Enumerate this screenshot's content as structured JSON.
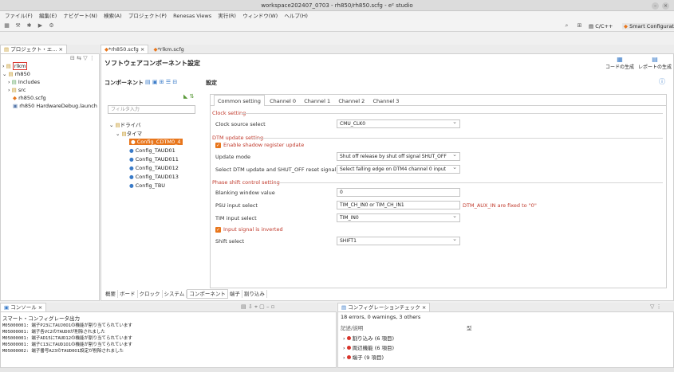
{
  "window": {
    "title": "workspace202407_0703 - rh850/rh850.scfg - e² studio"
  },
  "menu": [
    "ファイル(F)",
    "編集(E)",
    "ナビゲート(N)",
    "検索(A)",
    "プロジェクト(P)",
    "Renesas Views",
    "実行(R)",
    "ウィンドウ(W)",
    "ヘルプ(H)"
  ],
  "toolbar": {
    "perspective_cc": "C/C++",
    "perspective_sc": "Smart Configurator"
  },
  "explorer": {
    "tab_label": "プロジェクト・エ...",
    "items": [
      "rlkm",
      "rh850",
      "Includes",
      "src",
      "rh850.scfg",
      "rh850 HardwareDebug.launch"
    ]
  },
  "editor": {
    "tabs": [
      "*rh850.scfg",
      "*rlkm.scfg"
    ],
    "title": "ソフトウェアコンポーネント設定",
    "gen_code": "コードの生成",
    "gen_report": "レポートの生成",
    "component_label": "コンポーネント",
    "settings_label": "設定",
    "filter_placeholder": "フィルタ入力",
    "tree": [
      "ドライバ",
      "タイマ",
      "Config_CDTM0_4",
      "Config_TAUD01",
      "Config_TAUD011",
      "Config_TAUD012",
      "Config_TAUD013",
      "Config_TBU"
    ],
    "setting_tabs": [
      "Common setting",
      "Channel 0",
      "Channel 1",
      "Channel 2",
      "Channel 3"
    ],
    "clock_section": "Clock setting",
    "clock_source_label": "Clock source select",
    "clock_source_value": "CMU_CLK0",
    "dtm_section": "DTM update setting",
    "shadow_label": "Enable shadow register update",
    "update_mode_label": "Update mode",
    "update_mode_value": "Shut off release by shut off signal SHUT_OFF",
    "dtm_reset_label": "Select DTM update and SHUT_OFF reset signal",
    "dtm_reset_value": "Select falling edge on DTM4 channel 0 input",
    "phase_section": "Phase shift control setting",
    "blanking_label": "Blanking window value",
    "blanking_value": "0",
    "psu_label": "PSU input select",
    "psu_value": "TIM_CH_IN0 or TIM_CH_IN1",
    "psu_note": "DTM_AUX_IN are fixed to \"0\"",
    "tim_label": "TIM input select",
    "tim_value": "TIM_IN0",
    "inverted_label": "Input signal is inverted",
    "shift_label": "Shift select",
    "shift_value": "SHIFT1",
    "bottom_tabs": [
      "概要",
      "ボード",
      "クロック",
      "システム",
      "コンポーネント",
      "端子",
      "割り込み"
    ]
  },
  "console": {
    "tab_label": "コンソール",
    "subtitle": "スマート・コンフィグレータ出力",
    "lines": [
      "M05000001: 端子P23にTAUJ0O1の機能が割り当てられています",
      "M05000001: 端子各VC2のTAUD0が削除されました",
      "M05000001: 端子AD15にTAUD12の機能が割り当てられています",
      "M05000001: 端子C13にTAUD1O1の機能が割り当てられています",
      "M05000002: 端子番号A23のTAUD0O1設定が削除されました"
    ]
  },
  "config_check": {
    "tab_label": "コンフィグレーションチェック",
    "summary": "18 errors, 0 warnings, 3 others",
    "col_desc": "記述/説明",
    "col_type": "型",
    "items": [
      "割り込み (6 項目)",
      "周辺機能 (6 項目)",
      "端子 (9 項目)"
    ]
  }
}
